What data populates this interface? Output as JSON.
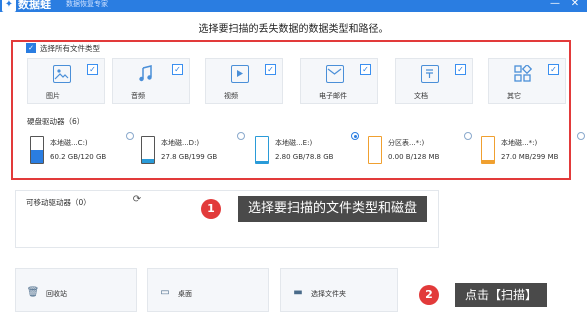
{
  "titlebar": {
    "app_name": "数据蛙",
    "subtitle": "数据恢复专家",
    "minimize": "—",
    "close": "✕"
  },
  "header": {
    "instruction": "选择要扫描的丢失数据的数据类型和路径。"
  },
  "select_all": {
    "label": "选择所有文件类型",
    "checked": true
  },
  "file_types": [
    {
      "label": "图片",
      "icon": "image-icon",
      "checked": true
    },
    {
      "label": "音频",
      "icon": "audio-icon",
      "checked": true
    },
    {
      "label": "视频",
      "icon": "video-icon",
      "checked": true
    },
    {
      "label": "电子邮件",
      "icon": "email-icon",
      "checked": true
    },
    {
      "label": "文档",
      "icon": "document-icon",
      "checked": true
    },
    {
      "label": "其它",
      "icon": "other-icon",
      "checked": true
    }
  ],
  "hard_drives": {
    "title": "硬盘驱动器（6）",
    "items": [
      {
        "name": "本地磁...C:)",
        "size": "60.2 GB/120 GB",
        "fill_color": "#2a7de1",
        "used_fraction": 0.5,
        "selected": false
      },
      {
        "name": "本地磁...D:)",
        "size": "27.8 GB/199 GB",
        "fill_color": "#2a9bd8",
        "used_fraction": 0.14,
        "selected": false
      },
      {
        "name": "本地磁...E:)",
        "size": "2.80 GB/78.8 GB",
        "fill_color": "#2a9bd8",
        "used_fraction": 0.04,
        "selected": true
      },
      {
        "name": "分区表...*:)",
        "size": "0.00 B/128 MB",
        "fill_color": "#f0a030",
        "used_fraction": 0.0,
        "selected": false
      },
      {
        "name": "本地磁...*:)",
        "size": "27.0 MB/299 MB",
        "fill_color": "#f0a030",
        "used_fraction": 0.09,
        "selected": false
      }
    ]
  },
  "removable": {
    "title": "可移动驱动器（0）"
  },
  "callouts": [
    {
      "number": "1",
      "text": "选择要扫描的文件类型和磁盘"
    },
    {
      "number": "2",
      "text": "点击【扫描】"
    }
  ],
  "bottom_items": [
    {
      "label": "回收站",
      "icon": "recycle-bin-icon"
    },
    {
      "label": "桌面",
      "icon": "desktop-icon"
    },
    {
      "label": "选择文件夹",
      "icon": "folder-icon"
    }
  ],
  "colors": {
    "accent": "#2a7de1",
    "highlight": "#e23a3a",
    "tooltip_bg": "#4a4a4a"
  }
}
